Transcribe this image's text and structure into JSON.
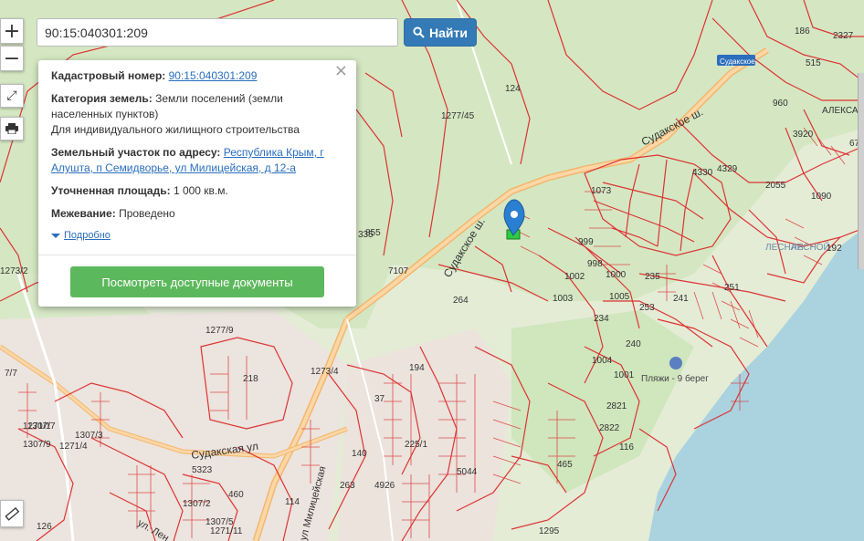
{
  "search": {
    "value": "90:15:040301:209",
    "button_label": "Найти"
  },
  "controls": {
    "zoom_in": "+",
    "zoom_out": "−"
  },
  "popup": {
    "close": "×",
    "cadastral_label": "Кадастровый номер:",
    "cadastral_value": "90:15:040301:209",
    "category_label": "Категория земель:",
    "category_value": "Земли поселений (земли населенных пунктов)",
    "usage": "Для индивидуального жилищного строительства",
    "address_label": "Земельный участок по адресу:",
    "address_value": "Республика Крым, г Алушта, п Семидворье, ул Милицейская, д 12-а",
    "area_label": "Уточненная площадь:",
    "area_value": "1 000 кв.м.",
    "survey_label": "Межевание:",
    "survey_value": "Проведено",
    "more_link": "Подробно",
    "docs_button": "Посмотреть доступные документы"
  },
  "map_labels": [
    {
      "text": "186"
    },
    {
      "text": "2327"
    },
    {
      "text": "515"
    },
    {
      "text": "АЛЕКСА"
    },
    {
      "text": "4330"
    },
    {
      "text": "4329"
    },
    {
      "text": "2055"
    },
    {
      "text": "1090"
    },
    {
      "text": "1073"
    },
    {
      "text": "999"
    },
    {
      "text": "998"
    },
    {
      "text": "1000"
    },
    {
      "text": "1005"
    },
    {
      "text": "1002"
    },
    {
      "text": "1003"
    },
    {
      "text": "234"
    },
    {
      "text": "235"
    },
    {
      "text": "241"
    },
    {
      "text": "251"
    },
    {
      "text": "253"
    },
    {
      "text": "240"
    },
    {
      "text": "1004"
    },
    {
      "text": "1001"
    },
    {
      "text": "2821"
    },
    {
      "text": "2822"
    },
    {
      "text": "116"
    },
    {
      "text": "465"
    },
    {
      "text": "5044"
    },
    {
      "text": "4926"
    },
    {
      "text": "263"
    },
    {
      "text": "140"
    },
    {
      "text": "114"
    },
    {
      "text": "225/1"
    },
    {
      "text": "37"
    },
    {
      "text": "194"
    },
    {
      "text": "218"
    },
    {
      "text": "7107"
    },
    {
      "text": "1273/4"
    },
    {
      "text": "1307/3"
    },
    {
      "text": "1271/4"
    },
    {
      "text": "1307/9"
    },
    {
      "text": "1271/1"
    },
    {
      "text": "5323"
    },
    {
      "text": "1307/2"
    },
    {
      "text": "1307/5"
    },
    {
      "text": "1271/11"
    },
    {
      "text": "126"
    },
    {
      "text": "1295"
    },
    {
      "text": "1273/2"
    },
    {
      "text": "1277/45"
    },
    {
      "text": "124"
    },
    {
      "text": "335"
    },
    {
      "text": "192"
    },
    {
      "text": "67"
    },
    {
      "text": "3920"
    },
    {
      "text": "960"
    },
    {
      "text": "264"
    },
    {
      "text": "460"
    },
    {
      "text": "1277/9"
    },
    {
      "text": "7/7"
    },
    {
      "text": "1307/7"
    },
    {
      "text": "855"
    }
  ],
  "road_labels": {
    "sudakskoe_top": "Судакское ш.",
    "sudakskoe_mid": "Судакское ш.",
    "sudakskaya": "Судакская ул",
    "lenin": "ул. Лен",
    "militseiskaya": "ул Милицейская",
    "lesnaya": "ЛЕСНАЯ",
    "lesnoi": "ЛЕСНОЙ",
    "beach": "Пляжи - 9 берег",
    "road_sign": "Судакское"
  },
  "colors": {
    "parcel": "#d33",
    "forest": "#cfe5bd",
    "sea": "#aad3df",
    "road": "#f7c98a",
    "accent": "#337ab7",
    "green_btn": "#5cb85c"
  }
}
